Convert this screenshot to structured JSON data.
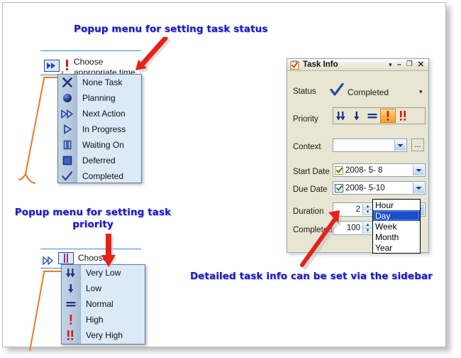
{
  "annotations": {
    "status_note": "Popup menu for setting task status",
    "priority_note": "Popup menu for setting task\npriority",
    "sidebar_note": "Detailed task info can be set via the sidebar"
  },
  "status_row": {
    "cell_text": "Choose\nappropriate time",
    "status_icon": "next-action-icon",
    "priority_icon": "high-priority-icon"
  },
  "status_menu": {
    "items": [
      {
        "label": "None Task",
        "icon": "x-cross-icon"
      },
      {
        "label": "Planning",
        "icon": "sphere-icon"
      },
      {
        "label": "Next Action",
        "icon": "double-triangle-icon"
      },
      {
        "label": "In Progress",
        "icon": "triangle-play-icon"
      },
      {
        "label": "Waiting On",
        "icon": "pause-bars-icon"
      },
      {
        "label": "Deferred",
        "icon": "square-icon"
      },
      {
        "label": "Completed",
        "icon": "checkmark-icon"
      }
    ]
  },
  "priority_row": {
    "cell_text": "Choose"
  },
  "priority_menu": {
    "items": [
      {
        "label": "Very Low",
        "icon": "double-down-arrow-icon"
      },
      {
        "label": "Low",
        "icon": "down-arrow-icon"
      },
      {
        "label": "Normal",
        "icon": "equals-icon"
      },
      {
        "label": "High",
        "icon": "exclamation-icon"
      },
      {
        "label": "Very High",
        "icon": "double-exclamation-icon"
      }
    ]
  },
  "task_info": {
    "title": "Task Info",
    "title_icon": "clipboard-check-icon",
    "title_buttons": [
      {
        "name": "menu-dropdown-button",
        "glyph": "▾"
      },
      {
        "name": "minimize-button",
        "glyph": "–"
      },
      {
        "name": "restore-button",
        "glyph": "❐"
      },
      {
        "name": "close-button",
        "glyph": "✕"
      }
    ],
    "fields": {
      "status": {
        "label": "Status",
        "value": "Completed",
        "icon": "checkmark-icon"
      },
      "priority": {
        "label": "Priority",
        "buttons": [
          {
            "name": "very-low",
            "icon": "double-down-arrow-icon",
            "selected": false
          },
          {
            "name": "low",
            "icon": "down-arrow-icon",
            "selected": false
          },
          {
            "name": "normal",
            "icon": "equals-icon",
            "selected": false
          },
          {
            "name": "high",
            "icon": "exclamation-icon",
            "selected": true
          },
          {
            "name": "very-high",
            "icon": "double-exclamation-icon",
            "selected": false
          }
        ]
      },
      "context": {
        "label": "Context",
        "value": "",
        "ellipsis_label": "..."
      },
      "start_date": {
        "label": "Start Date",
        "value": "2008- 5- 8",
        "checked": true
      },
      "due_date": {
        "label": "Due Date",
        "value": "2008- 5-10",
        "checked": true
      },
      "duration": {
        "label": "Duration",
        "value": "2",
        "unit": "Day"
      },
      "completed": {
        "label": "Completed",
        "value": "100"
      }
    },
    "duration_dropdown": {
      "options": [
        "Hour",
        "Day",
        "Week",
        "Month",
        "Year"
      ],
      "selected": "Day"
    }
  },
  "colors": {
    "annotation_blue": "#1a14d6",
    "arrow_red": "#e8201a",
    "connector_orange": "#f07820",
    "panel_beige": "#e8e5d2",
    "menu_blue": "#dce9f7",
    "highlight_blue": "#1b4ecb",
    "selected_orange": "#f7a027"
  }
}
